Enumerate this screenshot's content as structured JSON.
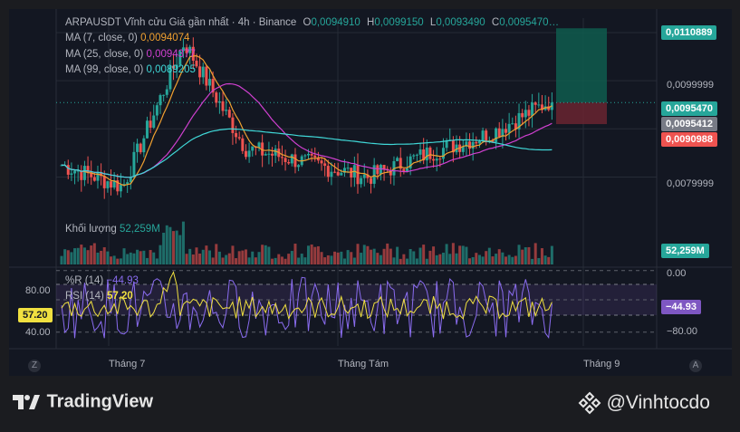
{
  "header": {
    "symbol": "ARPAUSDT Vĩnh cửu Giá gần nhất · 4h · Binance",
    "o_label": "O",
    "o_val": "0,0094910",
    "h_label": "H",
    "h_val": "0,0099150",
    "l_label": "L",
    "l_val": "0,0093490",
    "c_label": "C",
    "c_val": "0,0095470…"
  },
  "indicators": {
    "ma7": {
      "label": "MA (7, close, 0)",
      "value": "0,0094074",
      "color": "#f0a030"
    },
    "ma25": {
      "label": "MA (25, close, 0)",
      "value": "0,0094377",
      "color": "#d040d0"
    },
    "ma99": {
      "label": "MA (99, close, 0)",
      "value": "0,0089205",
      "color": "#40d8d8"
    },
    "volume": {
      "label": "Khối lượng",
      "value": "52,259M"
    },
    "wr": {
      "label": "%R (14)",
      "value": "−44.93",
      "color": "#8a6cf0"
    },
    "rsi": {
      "label": "RSI (14)",
      "value": "57.20",
      "color": "#f0e040"
    }
  },
  "price_axis": {
    "labels": [
      "0,0099999",
      "0,0079999"
    ],
    "tp_badge": "0,0110889",
    "last_badge": "0,0095470",
    "ma_badge": "0,0095412",
    "sl_badge": "0,0090988",
    "volume_badge": "52,259M"
  },
  "osc_axis": {
    "left_labels": [
      "80.00",
      "40.00"
    ],
    "right_labels": [
      "0.00",
      "−80.00"
    ],
    "rsi_badge": "57.20",
    "wr_badge": "−44.93"
  },
  "time_axis": {
    "labels": [
      "Tháng 7",
      "Tháng Tám",
      "Tháng 9"
    ]
  },
  "corner_left": "Z",
  "corner_right": "A",
  "footer": {
    "brand": "TradingView",
    "watermark": "@Vinhtocdo"
  },
  "colors": {
    "up": "#26a69a",
    "down": "#ef5350",
    "bg": "#131722",
    "grid": "#262b36",
    "tp": "#0f5c4e",
    "sl": "#6a2430"
  },
  "chart_data": {
    "type": "candlestick",
    "symbol": "ARPAUSDT",
    "interval": "4h",
    "x_axis_ticks": [
      "Tháng 7",
      "Tháng Tám",
      "Tháng 9"
    ],
    "y_axis_ticks": [
      0.0079999,
      0.0099999
    ],
    "ylim": [
      0.0072,
      0.0113
    ],
    "last_ohlc": {
      "open": 0.009491,
      "high": 0.009915,
      "low": 0.009349,
      "close": 0.009547
    },
    "close_path_approx": [
      {
        "period": "late June",
        "close": 0.00825
      },
      {
        "period": "early July low",
        "close": 0.0078
      },
      {
        "period": "early July spike",
        "close": 0.0108
      },
      {
        "period": "mid July",
        "close": 0.0086
      },
      {
        "period": "late July",
        "close": 0.0083
      },
      {
        "period": "early August",
        "close": 0.008
      },
      {
        "period": "mid August",
        "close": 0.0085
      },
      {
        "period": "late August",
        "close": 0.0089
      },
      {
        "period": "early Sept",
        "close": 0.0096
      }
    ],
    "position": {
      "entry": 0.009547,
      "take_profit": 0.0110889,
      "stop_loss": 0.0090988
    },
    "ma_last": {
      "ma7": 0.0094074,
      "ma25": 0.0094377,
      "ma99": 0.0089205
    },
    "volume_last": "52,259M",
    "oscillators": {
      "wr14_last": -44.93,
      "rsi14_last": 57.2,
      "rsi_levels": [
        80,
        40
      ],
      "wr_levels": [
        0,
        -80
      ]
    }
  }
}
